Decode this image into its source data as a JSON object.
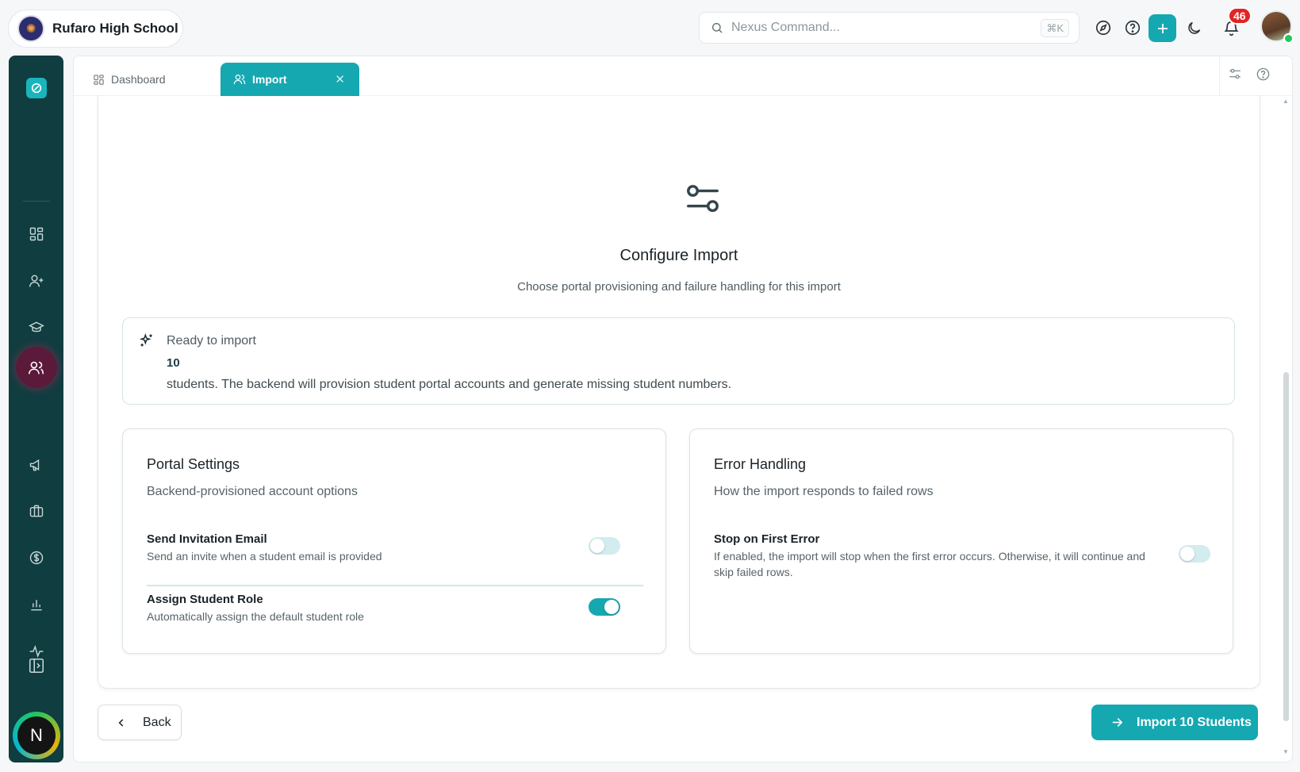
{
  "header": {
    "school_name": "Rufaro High School",
    "search_placeholder": "Nexus Command...",
    "search_shortcut": "⌘K",
    "notification_count": "46"
  },
  "sidebar": {
    "items": [
      "grid-icon",
      "user-plus-icon",
      "graduation-cap-icon",
      "sparkles-icon",
      "users-icon",
      "megaphone-icon",
      "briefcase-icon",
      "dollar-icon",
      "bar-chart-icon",
      "activity-icon"
    ],
    "active_item": "users-icon",
    "profile_initial": "N"
  },
  "tabs": [
    {
      "label": "Dashboard",
      "active": false
    },
    {
      "label": "Import",
      "active": true
    }
  ],
  "configure": {
    "title": "Configure Import",
    "subtitle": "Choose portal provisioning and failure handling for this import"
  },
  "ready": {
    "label": "Ready to import",
    "count": "10",
    "description": "students. The backend will provision student portal accounts and generate missing student numbers."
  },
  "portal_settings": {
    "title": "Portal Settings",
    "subtitle": "Backend-provisioned account options",
    "send_invite": {
      "name": "Send Invitation Email",
      "desc": "Send an invite when a student email is provided",
      "enabled": false
    },
    "assign_role": {
      "name": "Assign Student Role",
      "desc": "Automatically assign the default student role",
      "enabled": true
    }
  },
  "error_handling": {
    "title": "Error Handling",
    "subtitle": "How the import responds to failed rows",
    "stop_on_error": {
      "name": "Stop on First Error",
      "desc": "If enabled, the import will stop when the first error occurs. Otherwise, it will continue and skip failed rows.",
      "enabled": false
    }
  },
  "actions": {
    "back_label": "Back",
    "import_label": "Import 10 Students"
  },
  "colors": {
    "accent": "#15a8b1",
    "sidebar_bg": "#0f3d40",
    "badge": "#e02424"
  }
}
